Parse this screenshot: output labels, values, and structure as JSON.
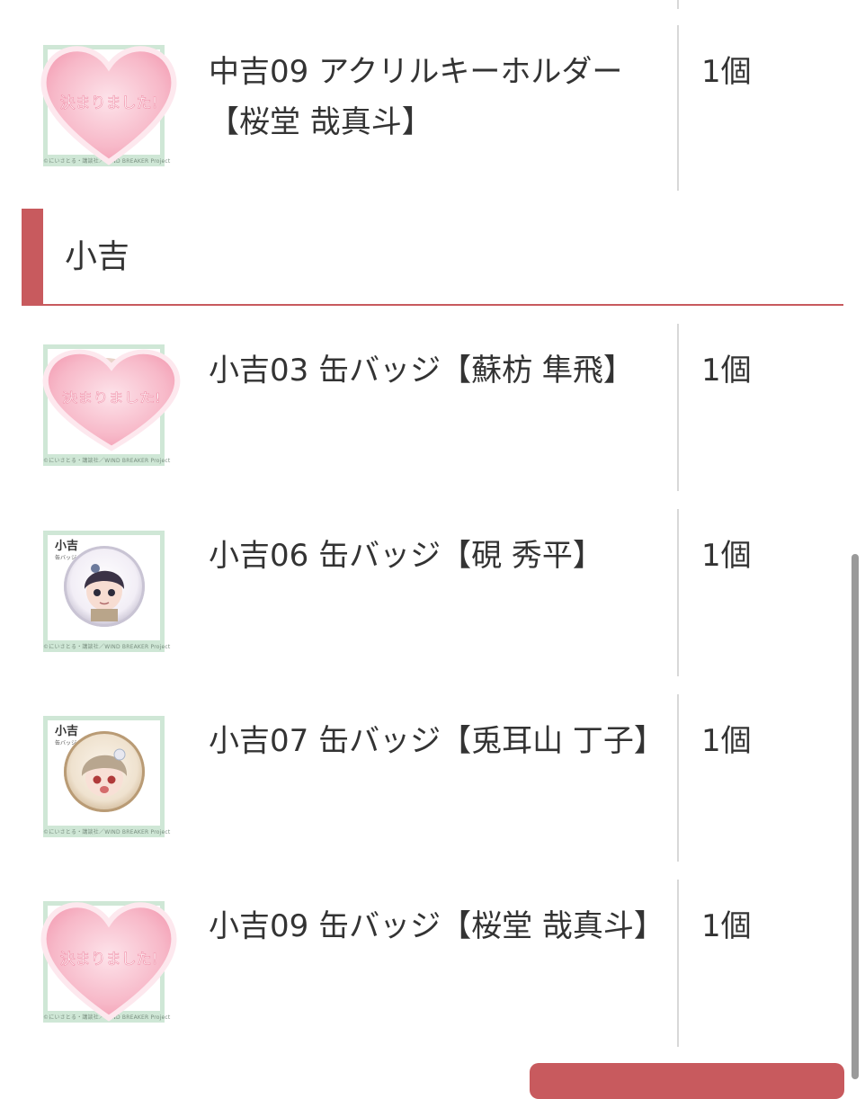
{
  "items_top": [
    {
      "name": "中吉09 アクリルキーホルダー【桜堂 哉真斗】",
      "qty": "1個",
      "thumb": "decided-heart",
      "overlay_text": "決まりました!",
      "copyright": "©にいさとる・講談社／WIND BREAKER Project"
    }
  ],
  "section": {
    "label": "小吉",
    "accent_color": "#c85a5e"
  },
  "items": [
    {
      "name": "小吉03 缶バッジ【蘇枋 隼飛】",
      "qty": "1個",
      "thumb": "decided-heart",
      "overlay_text": "決まりました!",
      "copyright": "©にいさとる・講談社／WIND BREAKER Project"
    },
    {
      "name": "小吉06 缶バッジ【硯 秀平】",
      "qty": "1個",
      "thumb": "badge",
      "badge_label": "小吉",
      "badge_sub": "缶バッジ",
      "copyright": "©にいさとる・講談社／WIND BREAKER Project"
    },
    {
      "name": "小吉07 缶バッジ【兎耳山 丁子】",
      "qty": "1個",
      "thumb": "badge",
      "badge_label": "小吉",
      "badge_sub": "缶バッジ",
      "copyright": "©にいさとる・講談社／WIND BREAKER Project"
    },
    {
      "name": "小吉09 缶バッジ【桜堂 哉真斗】",
      "qty": "1個",
      "thumb": "decided-heart",
      "overlay_text": "決まりました!",
      "copyright": "©にいさとる・講談社／WIND BREAKER Project"
    }
  ],
  "colors": {
    "heart_pink": "#f7b8c8",
    "thumb_border": "#cfe7d6",
    "accent": "#c85a5e"
  }
}
